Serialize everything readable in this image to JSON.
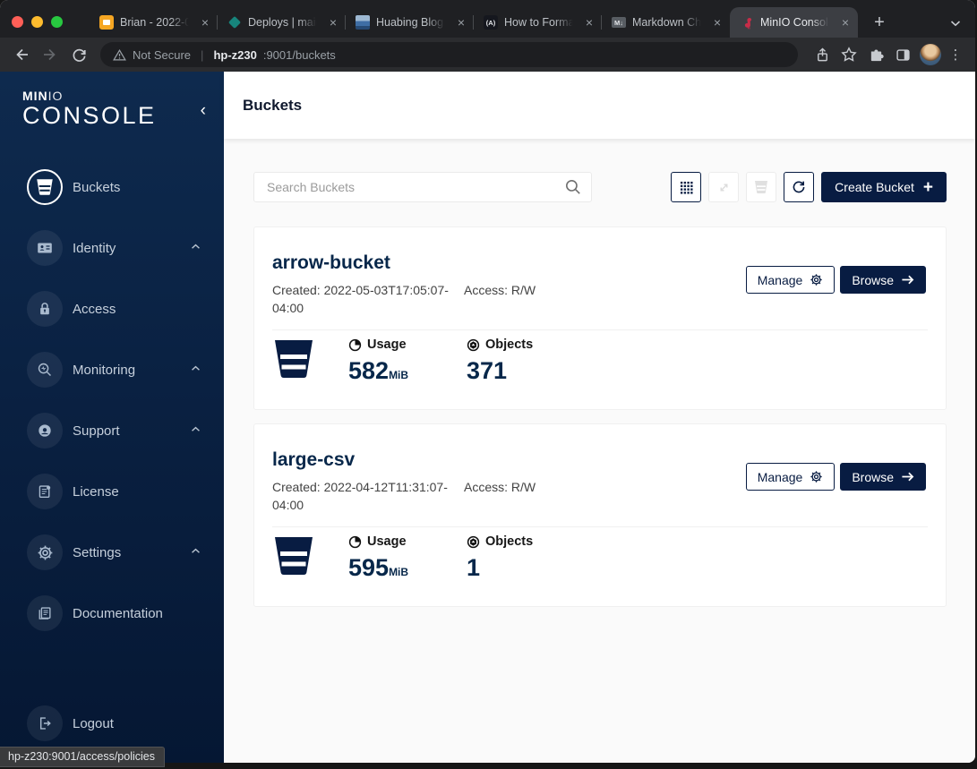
{
  "colors": {
    "accent_navy": "#081C42",
    "brand_red": "#C72C48",
    "sidebar_top": "#0E2A4E",
    "sidebar_bottom": "#051733",
    "page_bg": "#FAFAFA"
  },
  "browser": {
    "tabs": [
      {
        "title": "Brian - 2022-0",
        "icon": "document-icon"
      },
      {
        "title": "Deploys | maid",
        "icon": "diamond-icon"
      },
      {
        "title": "Huabing Blog |",
        "icon": "photo-icon"
      },
      {
        "title": "How to Forma",
        "icon": "a-badge-icon"
      },
      {
        "title": "Markdown Che",
        "icon": "markdown-icon"
      },
      {
        "title": "MinIO Console",
        "icon": "flamingo-icon",
        "active": true
      }
    ],
    "address": {
      "warning": "Not Secure",
      "host": "hp-z230",
      "rest": ":9001/buckets"
    }
  },
  "sidebar": {
    "logo": {
      "min": "MIN",
      "io": "IO",
      "console": "CONSOLE"
    },
    "items": [
      {
        "label": "Buckets",
        "icon": "bucket-icon",
        "active": true
      },
      {
        "label": "Identity",
        "icon": "id-card-icon",
        "chevron": true
      },
      {
        "label": "Access",
        "icon": "lock-icon"
      },
      {
        "label": "Monitoring",
        "icon": "magnifier-icon",
        "chevron": true
      },
      {
        "label": "Support",
        "icon": "support-icon",
        "chevron": true
      },
      {
        "label": "License",
        "icon": "license-icon"
      },
      {
        "label": "Settings",
        "icon": "gear-icon",
        "chevron": true
      },
      {
        "label": "Documentation",
        "icon": "book-icon"
      }
    ],
    "logout_label": "Logout"
  },
  "page": {
    "title": "Buckets",
    "search_placeholder": "Search Buckets",
    "create_button_label": "Create Bucket",
    "labels": {
      "manage": "Manage",
      "browse": "Browse",
      "usage": "Usage",
      "objects": "Objects"
    },
    "buckets": [
      {
        "name": "arrow-bucket",
        "created": "Created: 2022-05-03T17:05:07-",
        "created_offset": "04:00",
        "access": "Access: R/W",
        "usage_value": "582",
        "usage_unit": "MiB",
        "objects_value": "371"
      },
      {
        "name": "large-csv",
        "created": "Created: 2022-04-12T11:31:07-",
        "created_offset": "04:00",
        "access": "Access: R/W",
        "usage_value": "595",
        "usage_unit": "MiB",
        "objects_value": "1"
      }
    ]
  },
  "statusbar": {
    "text": "hp-z230:9001/access/policies"
  }
}
